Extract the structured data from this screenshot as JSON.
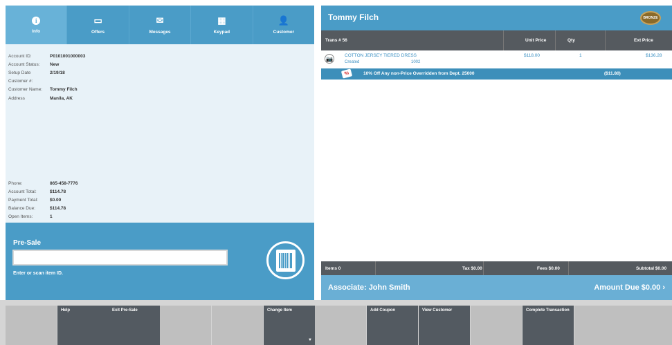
{
  "tabs": [
    {
      "label": "Info",
      "icon": "info-icon"
    },
    {
      "label": "Offers",
      "icon": "offers-icon"
    },
    {
      "label": "Messages",
      "icon": "envelope-icon"
    },
    {
      "label": "Keypad",
      "icon": "keypad-icon"
    },
    {
      "label": "Customer",
      "icon": "add-customer-icon"
    }
  ],
  "info": {
    "account_id_label": "Account ID:",
    "account_id": "P0101001000003",
    "account_status_label": "Account Status:",
    "account_status": "New",
    "setup_date_label": "Setup Date",
    "setup_date": "2/19/18",
    "customer_no_label": "Customer #:",
    "customer_no": "",
    "customer_name_label": "Customer Name:",
    "customer_name": "Tommy Filch",
    "address_label": "Address",
    "address": "Manila, AK",
    "phone_label": "Phone:",
    "phone": "865-458-7776",
    "account_total_label": "Account Total:",
    "account_total": "$114.78",
    "payment_total_label": "Payment Total:",
    "payment_total": "$0.00",
    "balance_due_label": "Balance Due:",
    "balance_due": "$114.78",
    "open_items_label": "Open Items:",
    "open_items": "1"
  },
  "presale": {
    "title": "Pre-Sale",
    "input_value": "",
    "hint": "Enter or scan item ID."
  },
  "transaction": {
    "customer_name": "Tommy Filch",
    "badge": "BRONZE",
    "columns": {
      "trans": "Trans # 56",
      "unit_price": "Unit Price",
      "qty": "Qty",
      "ext_price": "Ext Price"
    },
    "item": {
      "name": "COTTON JERSEY TIERED DRESS",
      "status": "Created",
      "code": "1002",
      "unit_price": "$118.00",
      "qty": "1",
      "ext_price": "$136.28"
    },
    "discount": {
      "text": "10% Off Any non-Price Overridden from Dept. 25000",
      "amount": "($11.80)"
    },
    "totals": {
      "items": "Items 0",
      "tax": "Tax $0.00",
      "fees": "Fees $0.00",
      "subtotal": "Subtotal $0.00"
    },
    "associate": "Associate: John Smith",
    "amount_due": "Amount Due  $0.00  ›"
  },
  "toolbar": [
    {
      "label": "",
      "state": "light"
    },
    {
      "label": "Help",
      "state": "dark"
    },
    {
      "label": "Exit Pre-Sale",
      "state": "dark"
    },
    {
      "label": "",
      "state": "light"
    },
    {
      "label": "",
      "state": "light"
    },
    {
      "label": "Change Item",
      "state": "dark"
    },
    {
      "label": "",
      "state": "light"
    },
    {
      "label": "Add Coupon",
      "state": "dark"
    },
    {
      "label": "View Customer",
      "state": "dark"
    },
    {
      "label": "",
      "state": "light"
    },
    {
      "label": "Complete Transaction",
      "state": "dark"
    },
    {
      "label": "",
      "state": "light"
    },
    {
      "label": "",
      "state": "light"
    }
  ],
  "colors": {
    "accent": "#4a9cc7",
    "dark": "#535a61",
    "panel": "#e8f2f8"
  }
}
